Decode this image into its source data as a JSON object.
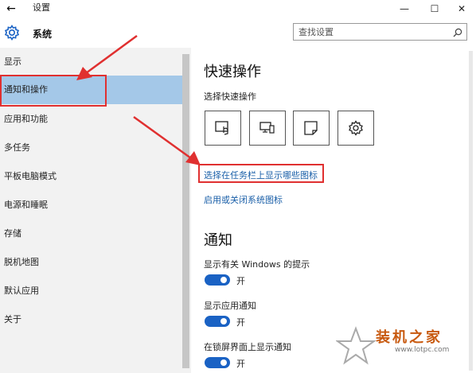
{
  "window": {
    "title": "设置",
    "back_glyph": "←",
    "minimize_glyph": "—",
    "maximize_glyph": "☐",
    "close_glyph": "✕"
  },
  "header": {
    "section_label": "系统",
    "search_placeholder": "查找设置"
  },
  "sidebar": {
    "items": [
      {
        "label": "显示"
      },
      {
        "label": "通知和操作",
        "selected": true
      },
      {
        "label": "应用和功能"
      },
      {
        "label": "多任务"
      },
      {
        "label": "平板电脑模式"
      },
      {
        "label": "电源和睡眠"
      },
      {
        "label": "存储"
      },
      {
        "label": "脱机地图"
      },
      {
        "label": "默认应用"
      },
      {
        "label": "关于"
      }
    ]
  },
  "main": {
    "quick_actions": {
      "heading": "快速操作",
      "subheading": "选择快速操作",
      "tiles": [
        {
          "icon": "tablet-mode-icon"
        },
        {
          "icon": "connect-icon"
        },
        {
          "icon": "note-icon"
        },
        {
          "icon": "all-settings-icon"
        }
      ],
      "link_taskbar_icons": "选择在任务栏上显示哪些图标",
      "link_system_icons": "启用或关闭系统图标"
    },
    "notifications": {
      "heading": "通知",
      "items": [
        {
          "label": "显示有关 Windows 的提示",
          "state": "开",
          "on": true
        },
        {
          "label": "显示应用通知",
          "state": "开",
          "on": true
        },
        {
          "label": "在锁屏界面上显示通知",
          "state": "开",
          "on": true
        }
      ]
    }
  },
  "watermark": {
    "title": "装机之家",
    "url": "www.lotpc.com"
  },
  "colors": {
    "selected_bg": "#a4c8e8",
    "link": "#1a5fa8",
    "toggle_on": "#1a62c4",
    "annotation": "#e03030",
    "watermark": "#c85a10"
  }
}
